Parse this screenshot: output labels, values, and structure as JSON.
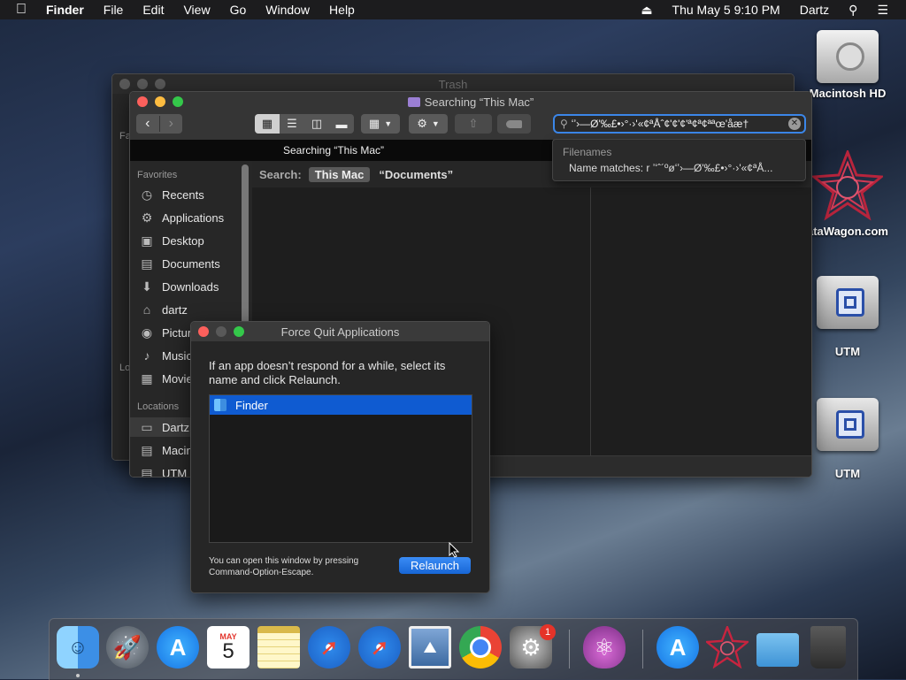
{
  "menubar": {
    "apple": "",
    "app": "Finder",
    "items": [
      "File",
      "Edit",
      "View",
      "Go",
      "Window",
      "Help"
    ],
    "clock": "Thu May 5  9:10 PM",
    "user": "Dartz"
  },
  "desktop": {
    "icons": [
      {
        "label": "Macintosh HD"
      },
      {
        "label": "ataWagon.com"
      },
      {
        "label": "UTM"
      },
      {
        "label": "UTM"
      }
    ]
  },
  "trash_window": {
    "title": "Trash",
    "sidebar_head": "Fa",
    "sidebar_head2": "Lo"
  },
  "finder": {
    "title": "Searching “This Mac”",
    "tab_title": "Searching “This Mac”",
    "search_value": "ʻʼ›—Ø'‰£•›°·›'«¢ªÅˆ¢'¢'¢'ª¢ª¢ªªœ'åæ†",
    "search_label": "Search:",
    "scope_selected": "This Mac",
    "scope_other": "“Documents”",
    "favorites_label": "Favorites",
    "favorites": [
      "Recents",
      "Applications",
      "Desktop",
      "Documents",
      "Downloads",
      "dartz",
      "Pictures",
      "Music",
      "Movies"
    ],
    "locations_label": "Locations",
    "locations": [
      "Dartz",
      "Macintosh HD",
      "UTM"
    ],
    "suggest": {
      "header": "Filenames",
      "item": "Name matches: r ʼʻˆ´ºøʻʼ›—Ø'‰£•›°·›'«¢ªÅ..."
    }
  },
  "force_quit": {
    "title": "Force Quit Applications",
    "instructions": "If an app doesn’t respond for a while, select its name and click Relaunch.",
    "apps": [
      "Finder"
    ],
    "footnote": "You can open this window by pressing Command-Option-Escape.",
    "button": "Relaunch"
  },
  "dock": {
    "items": [
      "Finder",
      "Launchpad",
      "App Store",
      "Calendar",
      "Notes",
      "Safari",
      "Safari",
      "Preview",
      "Chrome",
      "System Preferences",
      "Potion",
      "App Store",
      "DataWagon",
      "Folder",
      "Trash"
    ],
    "calendar_month": "MAY",
    "calendar_day": "5",
    "badge": "1"
  },
  "colors": {
    "accent": "#1766d6",
    "selection": "#0f5bd1"
  }
}
